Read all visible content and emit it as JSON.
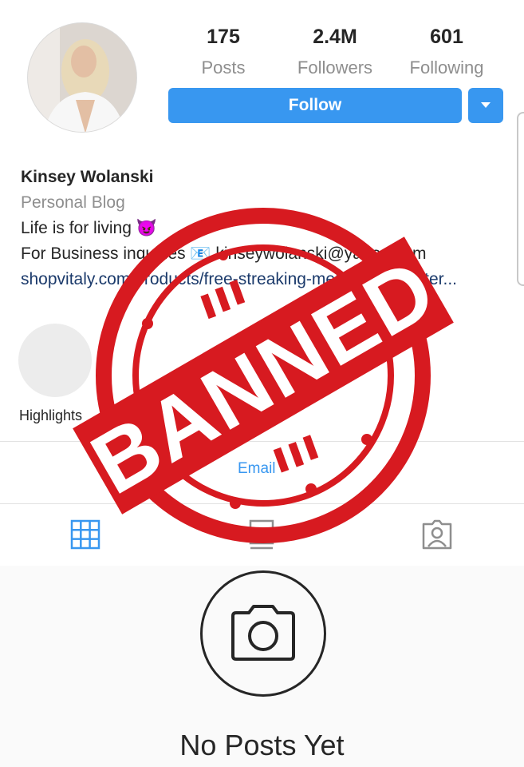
{
  "profile": {
    "stats": [
      {
        "value": "175",
        "label": "Posts"
      },
      {
        "value": "2.4M",
        "label": "Followers"
      },
      {
        "value": "601",
        "label": "Following"
      }
    ],
    "follow_label": "Follow",
    "dropdown_icon": "caret-down-icon",
    "accent_color": "#3897f0"
  },
  "bio": {
    "name": "Kinsey Wolanski",
    "category": "Personal Blog",
    "line1": "Life is for living",
    "line1_emoji": "😈",
    "line2": "For Business inquiries 📧 kinseywolanski@yahoo.com",
    "link": "shopvitaly.com/products/free-streaking-merch-and-poster..."
  },
  "highlights": {
    "label": "Highlights"
  },
  "actions": {
    "email_label": "Email"
  },
  "tabs": [
    {
      "name": "grid-icon",
      "active": true
    },
    {
      "name": "igtv-icon",
      "active": false
    },
    {
      "name": "tagged-icon",
      "active": false
    }
  ],
  "empty_state": {
    "icon": "camera-icon",
    "title": "No Posts Yet"
  },
  "stamp": {
    "text": "BANNED",
    "color": "#d71a20"
  }
}
